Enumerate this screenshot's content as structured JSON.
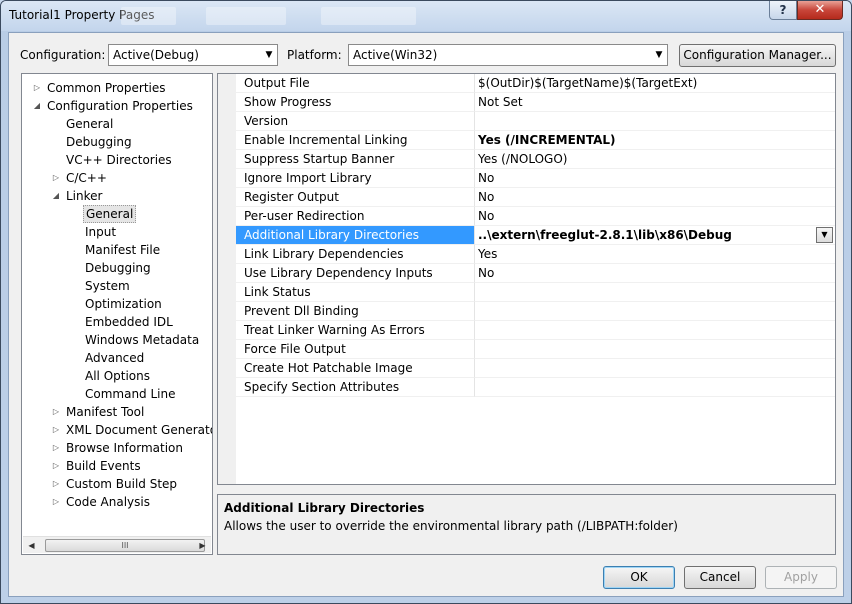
{
  "window": {
    "title": "Tutorial1 Property Pages",
    "help": "?",
    "close": "✕"
  },
  "config_bar": {
    "configuration_label": "Configuration:",
    "configuration_value": "Active(Debug)",
    "platform_label": "Platform:",
    "platform_value": "Active(Win32)",
    "manager_button": "Configuration Manager..."
  },
  "tree": {
    "common_properties": "Common Properties",
    "configuration_properties": "Configuration Properties",
    "general": "General",
    "debugging": "Debugging",
    "vcpp_directories": "VC++ Directories",
    "cpp": "C/C++",
    "linker": "Linker",
    "linker_children": [
      "General",
      "Input",
      "Manifest File",
      "Debugging",
      "System",
      "Optimization",
      "Embedded IDL",
      "Windows Metadata",
      "Advanced",
      "All Options",
      "Command Line"
    ],
    "after_linker": [
      "Manifest Tool",
      "XML Document Generator",
      "Browse Information",
      "Build Events",
      "Custom Build Step",
      "Code Analysis"
    ],
    "scroll_thumb": "III"
  },
  "properties": [
    {
      "name": "Output File",
      "value": "$(OutDir)$(TargetName)$(TargetExt)"
    },
    {
      "name": "Show Progress",
      "value": "Not Set"
    },
    {
      "name": "Version",
      "value": ""
    },
    {
      "name": "Enable Incremental Linking",
      "value": "Yes (/INCREMENTAL)",
      "bold": true
    },
    {
      "name": "Suppress Startup Banner",
      "value": "Yes (/NOLOGO)"
    },
    {
      "name": "Ignore Import Library",
      "value": "No"
    },
    {
      "name": "Register Output",
      "value": "No"
    },
    {
      "name": "Per-user Redirection",
      "value": "No"
    },
    {
      "name": "Additional Library Directories",
      "value": "..\\extern\\freeglut-2.8.1\\lib\\x86\\Debug",
      "selected": true
    },
    {
      "name": "Link Library Dependencies",
      "value": "Yes"
    },
    {
      "name": "Use Library Dependency Inputs",
      "value": "No"
    },
    {
      "name": "Link Status",
      "value": ""
    },
    {
      "name": "Prevent Dll Binding",
      "value": ""
    },
    {
      "name": "Treat Linker Warning As Errors",
      "value": ""
    },
    {
      "name": "Force File Output",
      "value": ""
    },
    {
      "name": "Create Hot Patchable Image",
      "value": ""
    },
    {
      "name": "Specify Section Attributes",
      "value": ""
    }
  ],
  "description": {
    "title": "Additional Library Directories",
    "text": "Allows the user to override the environmental library path (/LIBPATH:folder)"
  },
  "buttons": {
    "ok": "OK",
    "cancel": "Cancel",
    "apply": "Apply"
  }
}
